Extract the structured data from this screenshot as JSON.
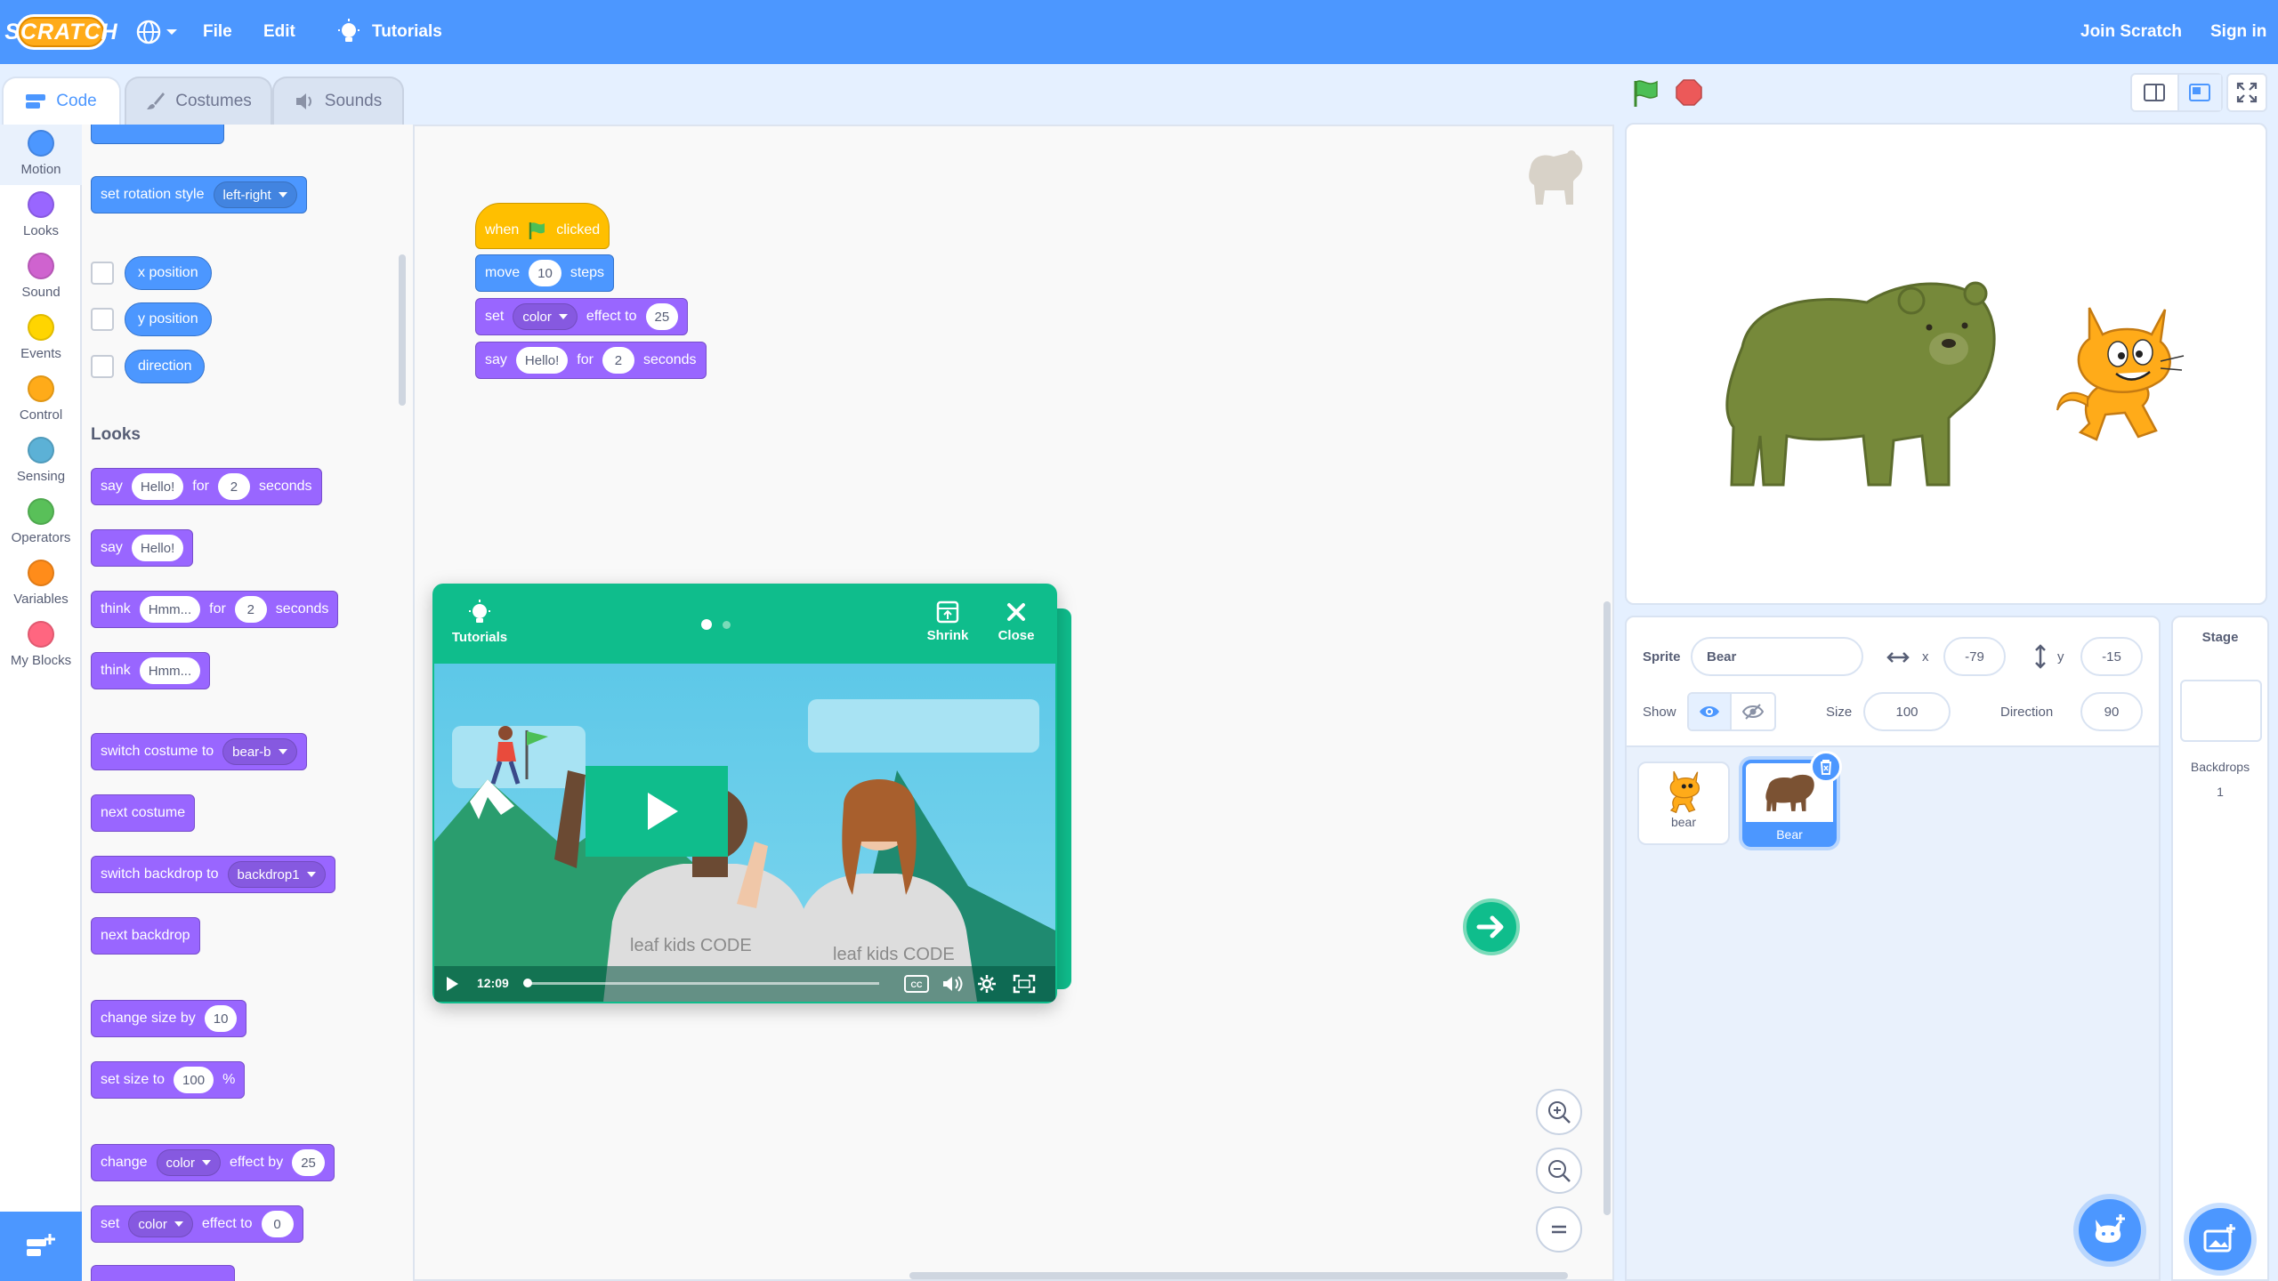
{
  "menubar": {
    "logo": "SCRATCH",
    "file": "File",
    "edit": "Edit",
    "tutorials": "Tutorials",
    "join": "Join Scratch",
    "signin": "Sign in"
  },
  "tabs": {
    "code": "Code",
    "costumes": "Costumes",
    "sounds": "Sounds"
  },
  "categories": [
    {
      "label": "Motion",
      "color": "#4c97ff"
    },
    {
      "label": "Looks",
      "color": "#9966ff"
    },
    {
      "label": "Sound",
      "color": "#cf63cf"
    },
    {
      "label": "Events",
      "color": "#ffd500"
    },
    {
      "label": "Control",
      "color": "#ffab19"
    },
    {
      "label": "Sensing",
      "color": "#5cb1d6"
    },
    {
      "label": "Operators",
      "color": "#59c059"
    },
    {
      "label": "Variables",
      "color": "#ff8c1a"
    },
    {
      "label": "My Blocks",
      "color": "#ff6680"
    }
  ],
  "palette": {
    "rotation": {
      "label": "set rotation style",
      "value": "left-right"
    },
    "reporters": [
      "x position",
      "y position",
      "direction"
    ],
    "looks_heading": "Looks",
    "say_for": {
      "a": "say",
      "msg": "Hello!",
      "b": "for",
      "n": "2",
      "c": "seconds"
    },
    "say": {
      "a": "say",
      "msg": "Hello!"
    },
    "think_for": {
      "a": "think",
      "msg": "Hmm...",
      "b": "for",
      "n": "2",
      "c": "seconds"
    },
    "think": {
      "a": "think",
      "msg": "Hmm..."
    },
    "switch_costume": {
      "a": "switch costume to",
      "v": "bear-b"
    },
    "next_costume": "next costume",
    "switch_backdrop": {
      "a": "switch backdrop to",
      "v": "backdrop1"
    },
    "next_backdrop": "next backdrop",
    "change_size": {
      "a": "change size by",
      "v": "10"
    },
    "set_size": {
      "a": "set size to",
      "v": "100",
      "b": "%"
    },
    "change_effect": {
      "a": "change",
      "v": "color",
      "b": "effect by",
      "n": "25"
    },
    "set_effect": {
      "a": "set",
      "v": "color",
      "b": "effect to",
      "n": "0"
    }
  },
  "script": {
    "hat": {
      "a": "when",
      "b": "clicked"
    },
    "move": {
      "a": "move",
      "n": "10",
      "b": "steps"
    },
    "seteffect": {
      "a": "set",
      "v": "color",
      "b": "effect to",
      "n": "25"
    },
    "say": {
      "a": "say",
      "msg": "Hello!",
      "b": "for",
      "n": "2",
      "c": "seconds"
    }
  },
  "tutorial": {
    "title": "Tutorials",
    "shrink": "Shrink",
    "close": "Close",
    "time": "12:09",
    "shirt_text": "leaf kids CODE",
    "shirt_text2": "leaf kids CODE"
  },
  "sprite_info": {
    "sprite_label": "Sprite",
    "sprite_name": "Bear",
    "x_label": "x",
    "x": "-79",
    "y_label": "y",
    "y": "-15",
    "show_label": "Show",
    "size_label": "Size",
    "size": "100",
    "direction_label": "Direction",
    "direction": "90"
  },
  "sprites": [
    {
      "name": "bear",
      "selected": false
    },
    {
      "name": "Bear",
      "selected": true
    }
  ],
  "stage_pane": {
    "title": "Stage",
    "backdrops_label": "Backdrops",
    "backdrops_count": "1"
  }
}
